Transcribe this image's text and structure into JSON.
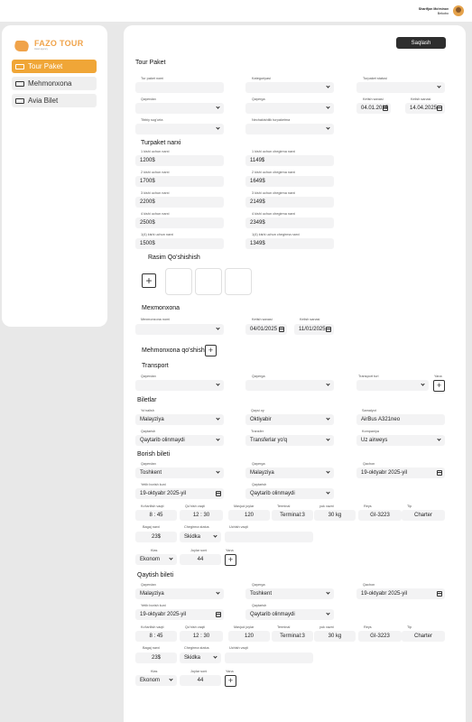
{
  "user": {
    "name": "Sharifjon Mo'minov",
    "role": "Bekobo"
  },
  "brand": {
    "name": "FAZO TOUR",
    "tagline": "travel agency",
    "accent": "#f0a637"
  },
  "nav": [
    {
      "label": "Tour Paket",
      "icon": "ticket-icon",
      "active": true
    },
    {
      "label": "Mehmonxona",
      "icon": "hotel-icon",
      "active": false
    },
    {
      "label": "Avia Bilet",
      "icon": "plane-icon",
      "active": false
    }
  ],
  "save_label": "Saqlash",
  "tour": {
    "title": "Tour Paket",
    "name_label": "Tur paket nomi",
    "category_label": "Kategoriyasi",
    "status_label": "Turpaket statusi",
    "from_label": "Qayerdan",
    "to_label": "Qayerga",
    "depart_label": "Ketish sanasi",
    "depart_value": "04.01.2025",
    "arrive_label": "Kelish sanasi",
    "arrive_value": "14.04.2025",
    "medical_label": "Tibbiy sug'urta",
    "nights_label": "Nechakishilik turpaketma"
  },
  "prices": {
    "title": "Turpaket narxi",
    "rows": [
      {
        "label": "1 kishi uchun narxi",
        "value": "1200$",
        "dlabel": "1 kishi uchun chegirma narxi",
        "dvalue": "1149$"
      },
      {
        "label": "2 kishi uchun narxi",
        "value": "1700$",
        "dlabel": "2 kishi uchun chegirma narxi",
        "dvalue": "1649$"
      },
      {
        "label": "3 kishi uchun narxi",
        "value": "2200$",
        "dlabel": "3 kishi uchun chegirma narxi",
        "dvalue": "2149$"
      },
      {
        "label": "4 kishi uchun narxi",
        "value": "2500$",
        "dlabel": "4 kishi uchun chegirma narxi",
        "dvalue": "2349$"
      },
      {
        "label": "1(4) kishi uchun narxi",
        "value": "1500$",
        "dlabel": "1(4) kishi uchun chegirma narxi",
        "dvalue": "1349$"
      }
    ]
  },
  "images": {
    "title": "Rasim Qo'shishish"
  },
  "hotel": {
    "title": "Mexmonxona",
    "name_label": "Mexmonxona nomi",
    "in_label": "Ketish sanasi",
    "in_value": "04/01/2025",
    "out_label": "Kelish sanasi",
    "out_value": "11/01/2025",
    "add_label": "Mehmonxona qo'shish"
  },
  "transport": {
    "title": "Transport",
    "from_label": "Qayerdan",
    "to_label": "Qayerga",
    "type_label": "Transport turi",
    "add_label": "Yana"
  },
  "tickets": {
    "title": "Biletlar",
    "r1": [
      {
        "label": "Yo'nalish",
        "value": "Malayziya"
      },
      {
        "label": "Qaysi oy",
        "value": "Oktiyabir"
      },
      {
        "label": "Samalyot",
        "value": "AirBus A321neo"
      }
    ],
    "r2": [
      {
        "label": "Qaytarish",
        "value": "Qaytarib olinmaydi"
      },
      {
        "label": "Transfer",
        "value": "Transferlar yo'q"
      },
      {
        "label": "Kompaniya",
        "value": "Uz airweys"
      }
    ]
  },
  "outbound": {
    "title": "Borish  bileti",
    "from_label": "Qayerdan",
    "from_value": "Toshkent",
    "to_label": "Qayerga",
    "to_value": "Malayziya",
    "when_label": "Qachon",
    "when_value": "19-oktyabr 2025-yil",
    "ret_label": "Yetib borish kuni",
    "ret_value": "19-oktyabr 2025-yil",
    "refund_label": "Qaytarish",
    "refund_value": "Qaytarib olinmaydi",
    "times": [
      {
        "label": "Ko'tarilish vaqti",
        "value": "8 : 45"
      },
      {
        "label": "Qo'nish vaqti",
        "value": "12 : 30"
      },
      {
        "label": "Mavjud joylar",
        "value": "120"
      },
      {
        "label": "Terminal",
        "value": "Terminal:3"
      },
      {
        "label": "yuk vazni",
        "value": "30 kg"
      },
      {
        "label": "Reys",
        "value": "GI-3223"
      },
      {
        "label": "Tip",
        "value": "Charter"
      }
    ],
    "baggage_label": "Bagaj narxi",
    "baggage_value": "23$",
    "disc_label": "Chegirma status",
    "disc_value": "Skidka",
    "fly_label": "Uchish vaqti",
    "class_label": "Klas",
    "class_value": "Ekonom",
    "seats_label": "Joylar soni",
    "seats_value": "44",
    "more_label": "Yana"
  },
  "inbound": {
    "title": "Qaytish  bileti",
    "from_label": "Qayerdan",
    "from_value": "Malayziya",
    "to_label": "Qayerga",
    "to_value": "Toshkent",
    "when_label": "Qachon",
    "when_value": "19-oktyabr 2025-yil",
    "ret_label": "Yetib borish kuni",
    "ret_value": "19-oktyabr 2025-yil",
    "refund_label": "Qaytarish",
    "refund_value": "Qaytarib olinmaydi",
    "times": [
      {
        "label": "Ko'tarilish vaqti",
        "value": "8 : 45"
      },
      {
        "label": "Qo'nish vaqti",
        "value": "12 : 30"
      },
      {
        "label": "Mavjud joylar",
        "value": "120"
      },
      {
        "label": "Terminal",
        "value": "Terminal:3"
      },
      {
        "label": "yuk vazni",
        "value": "30 kg"
      },
      {
        "label": "Reys",
        "value": "GI-3223"
      },
      {
        "label": "Tip",
        "value": "Charter"
      }
    ],
    "baggage_label": "Bagaj narxi",
    "baggage_value": "23$",
    "disc_label": "Chegirma status",
    "disc_value": "Skidka",
    "fly_label": "Uchish vaqti",
    "class_label": "Klas",
    "class_value": "Ekonom",
    "seats_label": "Joylar soni",
    "seats_value": "44",
    "more_label": "Yana"
  }
}
